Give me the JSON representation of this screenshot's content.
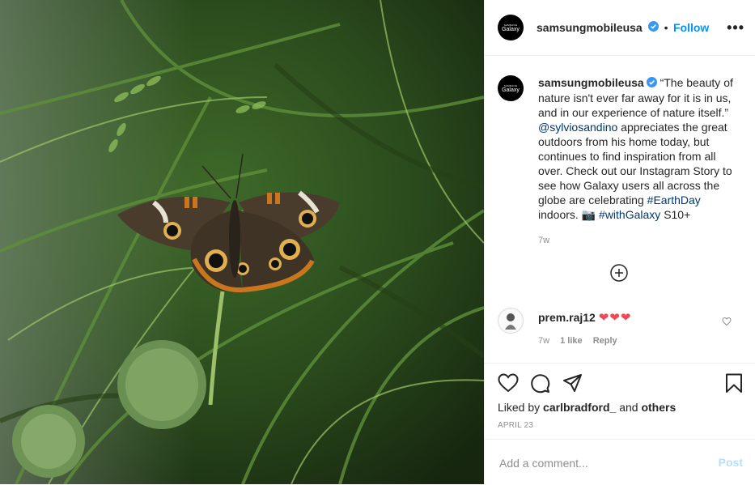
{
  "post": {
    "username": "samsungmobileusa",
    "avatar_text": "Galaxy",
    "avatar_small_text": "SAMSUNG",
    "follow_sep": "•",
    "follow_label": "Follow",
    "more_label": "•••",
    "caption_part1": "“The beauty of nature isn't ever far away for it is in us, and in our experience of nature itself.”",
    "mention": "@sylviosandino",
    "caption_part2": "appreciates the great outdoors from his home today, but continues to find inspiration from all over. Check out our Instagram Story to see how Galaxy users all across the globe are celebrating",
    "hashtag1": "#EarthDay",
    "caption_part3": "indoors. 📷",
    "hashtag2": "#withGalaxy",
    "caption_part4": "S10+",
    "time": "7w"
  },
  "comment": {
    "username": "prem.raj12",
    "text": "❤❤❤",
    "time": "7w",
    "likes": "1 like",
    "reply": "Reply"
  },
  "footer": {
    "liked_by_prefix": "Liked by",
    "liked_by_user": "carlbradford_",
    "liked_by_and": "and",
    "liked_by_others": "others",
    "date": "APRIL 23",
    "comment_placeholder": "Add a comment...",
    "post_label": "Post"
  },
  "colors": {
    "accent": "#0095f6",
    "verified": "#3897f0",
    "heart": "#ed4956"
  }
}
